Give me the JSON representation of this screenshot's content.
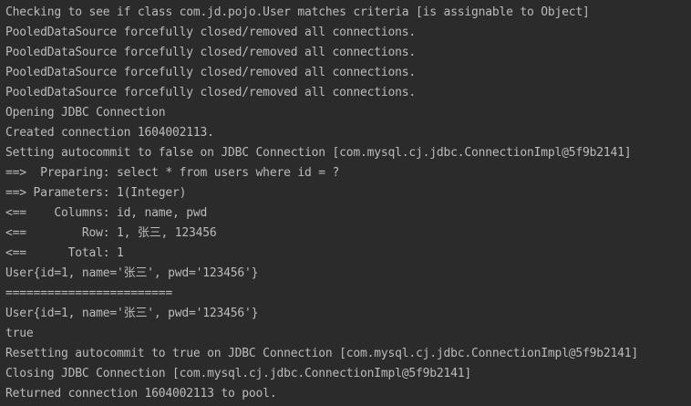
{
  "console": {
    "lines": [
      "Checking to see if class com.jd.pojo.User matches criteria [is assignable to Object]",
      "PooledDataSource forcefully closed/removed all connections.",
      "PooledDataSource forcefully closed/removed all connections.",
      "PooledDataSource forcefully closed/removed all connections.",
      "PooledDataSource forcefully closed/removed all connections.",
      "Opening JDBC Connection",
      "Created connection 1604002113.",
      "Setting autocommit to false on JDBC Connection [com.mysql.cj.jdbc.ConnectionImpl@5f9b2141]",
      "==>  Preparing: select * from users where id = ?",
      "==> Parameters: 1(Integer)",
      "<==    Columns: id, name, pwd",
      "<==        Row: 1, 张三, 123456",
      "<==      Total: 1",
      "User{id=1, name='张三', pwd='123456'}",
      "========================",
      "User{id=1, name='张三', pwd='123456'}",
      "true",
      "Resetting autocommit to true on JDBC Connection [com.mysql.cj.jdbc.ConnectionImpl@5f9b2141]",
      "Closing JDBC Connection [com.mysql.cj.jdbc.ConnectionImpl@5f9b2141]",
      "Returned connection 1604002113 to pool."
    ]
  },
  "colors": {
    "background": "#2b2b2b",
    "text": "#bbbbbb"
  }
}
